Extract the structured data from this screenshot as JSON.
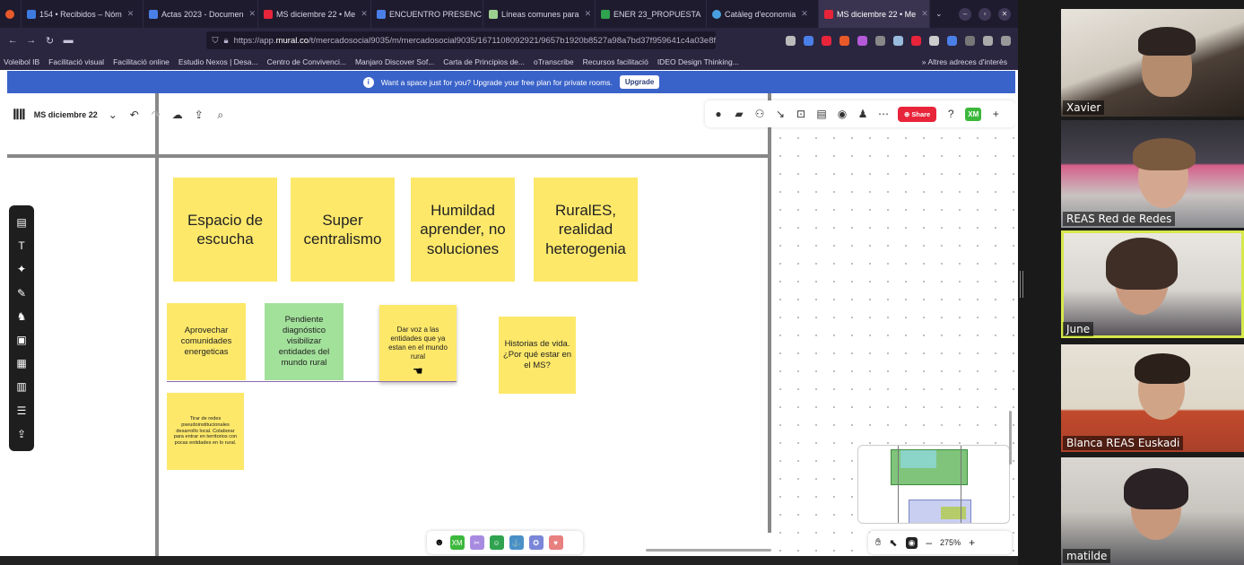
{
  "browser": {
    "tabs": [
      {
        "label": "154 • Recibidos – Nóm",
        "color": "#3d7be0",
        "active": false
      },
      {
        "label": "Actas 2023 - Documen",
        "color": "#4a7fe8",
        "active": false
      },
      {
        "label": "MS diciembre 22 • Me",
        "color": "#e8243a",
        "active": false
      },
      {
        "label": "ENCUENTRO PRESENC",
        "color": "#4a7fe8",
        "active": false
      },
      {
        "label": "Líneas comunes para",
        "color": "#9bd08f",
        "active": false
      },
      {
        "label": "ENER 23_PROPUESTA",
        "color": "#2fa34f",
        "active": false
      },
      {
        "label": "Catàleg d'economia",
        "color": "#49a0e0",
        "active": false
      },
      {
        "label": "MS diciembre 22 • Me",
        "color": "#e8243a",
        "active": true
      }
    ],
    "url_prefix": "https://app.",
    "url_host": "mural.co",
    "url_path": "/t/mercadosocial9035/m/mercadosocial9035/1671108092921/9657b1920b8527a98a7bd37f959641c4a03e8f9b?s",
    "bookmarks": [
      "Voleibol IB",
      "Facilitació visual",
      "Facilitació online",
      "Estudio Nexos | Desa...",
      "Centro de Convivenci...",
      "Manjaro Discover Sof...",
      "Carta de Principios de...",
      "oTranscribe",
      "Recursos facilitació",
      "IDEO Design Thinking..."
    ],
    "bookmarks_more": "»",
    "bookmarks_right": "Altres adreces d'interès"
  },
  "banner": {
    "text": "Want a space just for you? Upgrade your free plan for private rooms.",
    "button": "Upgrade"
  },
  "mural": {
    "name": "MS diciembre 22",
    "share_label": "Share",
    "avatar_initials": "XM",
    "zoom": "275%",
    "top_stickies": [
      {
        "text": "Espacio de escucha"
      },
      {
        "text": "Super centralismo"
      },
      {
        "text": "Humildad aprender, no soluciones"
      },
      {
        "text": "RuralES, realidad heterogenia"
      }
    ],
    "mid_stickies": [
      {
        "text": "Aprovechar comunidades energeticas"
      },
      {
        "text": "Pendiente diagnóstico visibilizar entidades del mundo rural"
      },
      {
        "text": "Dar voz a las entidades que ya estan en el mundo rural"
      },
      {
        "text": "Historias de vida. ¿Por qué estar en el MS?"
      }
    ],
    "small_sticky": "Tirar de redes pseudoinstitucionales desarrollo local. Colaborar para entrar en territorios con pocas entidades en lo rural.",
    "colors": {
      "yellow": "#fde86a",
      "green": "#a2e19a",
      "share": "#e8243a",
      "banner": "#3a63c9"
    }
  },
  "participants": [
    {
      "name": "Xavier"
    },
    {
      "name": "REAS Red de Redes"
    },
    {
      "name": "June",
      "active": true
    },
    {
      "name": "Blanca REAS Euskadi"
    },
    {
      "name": "matilde"
    }
  ]
}
